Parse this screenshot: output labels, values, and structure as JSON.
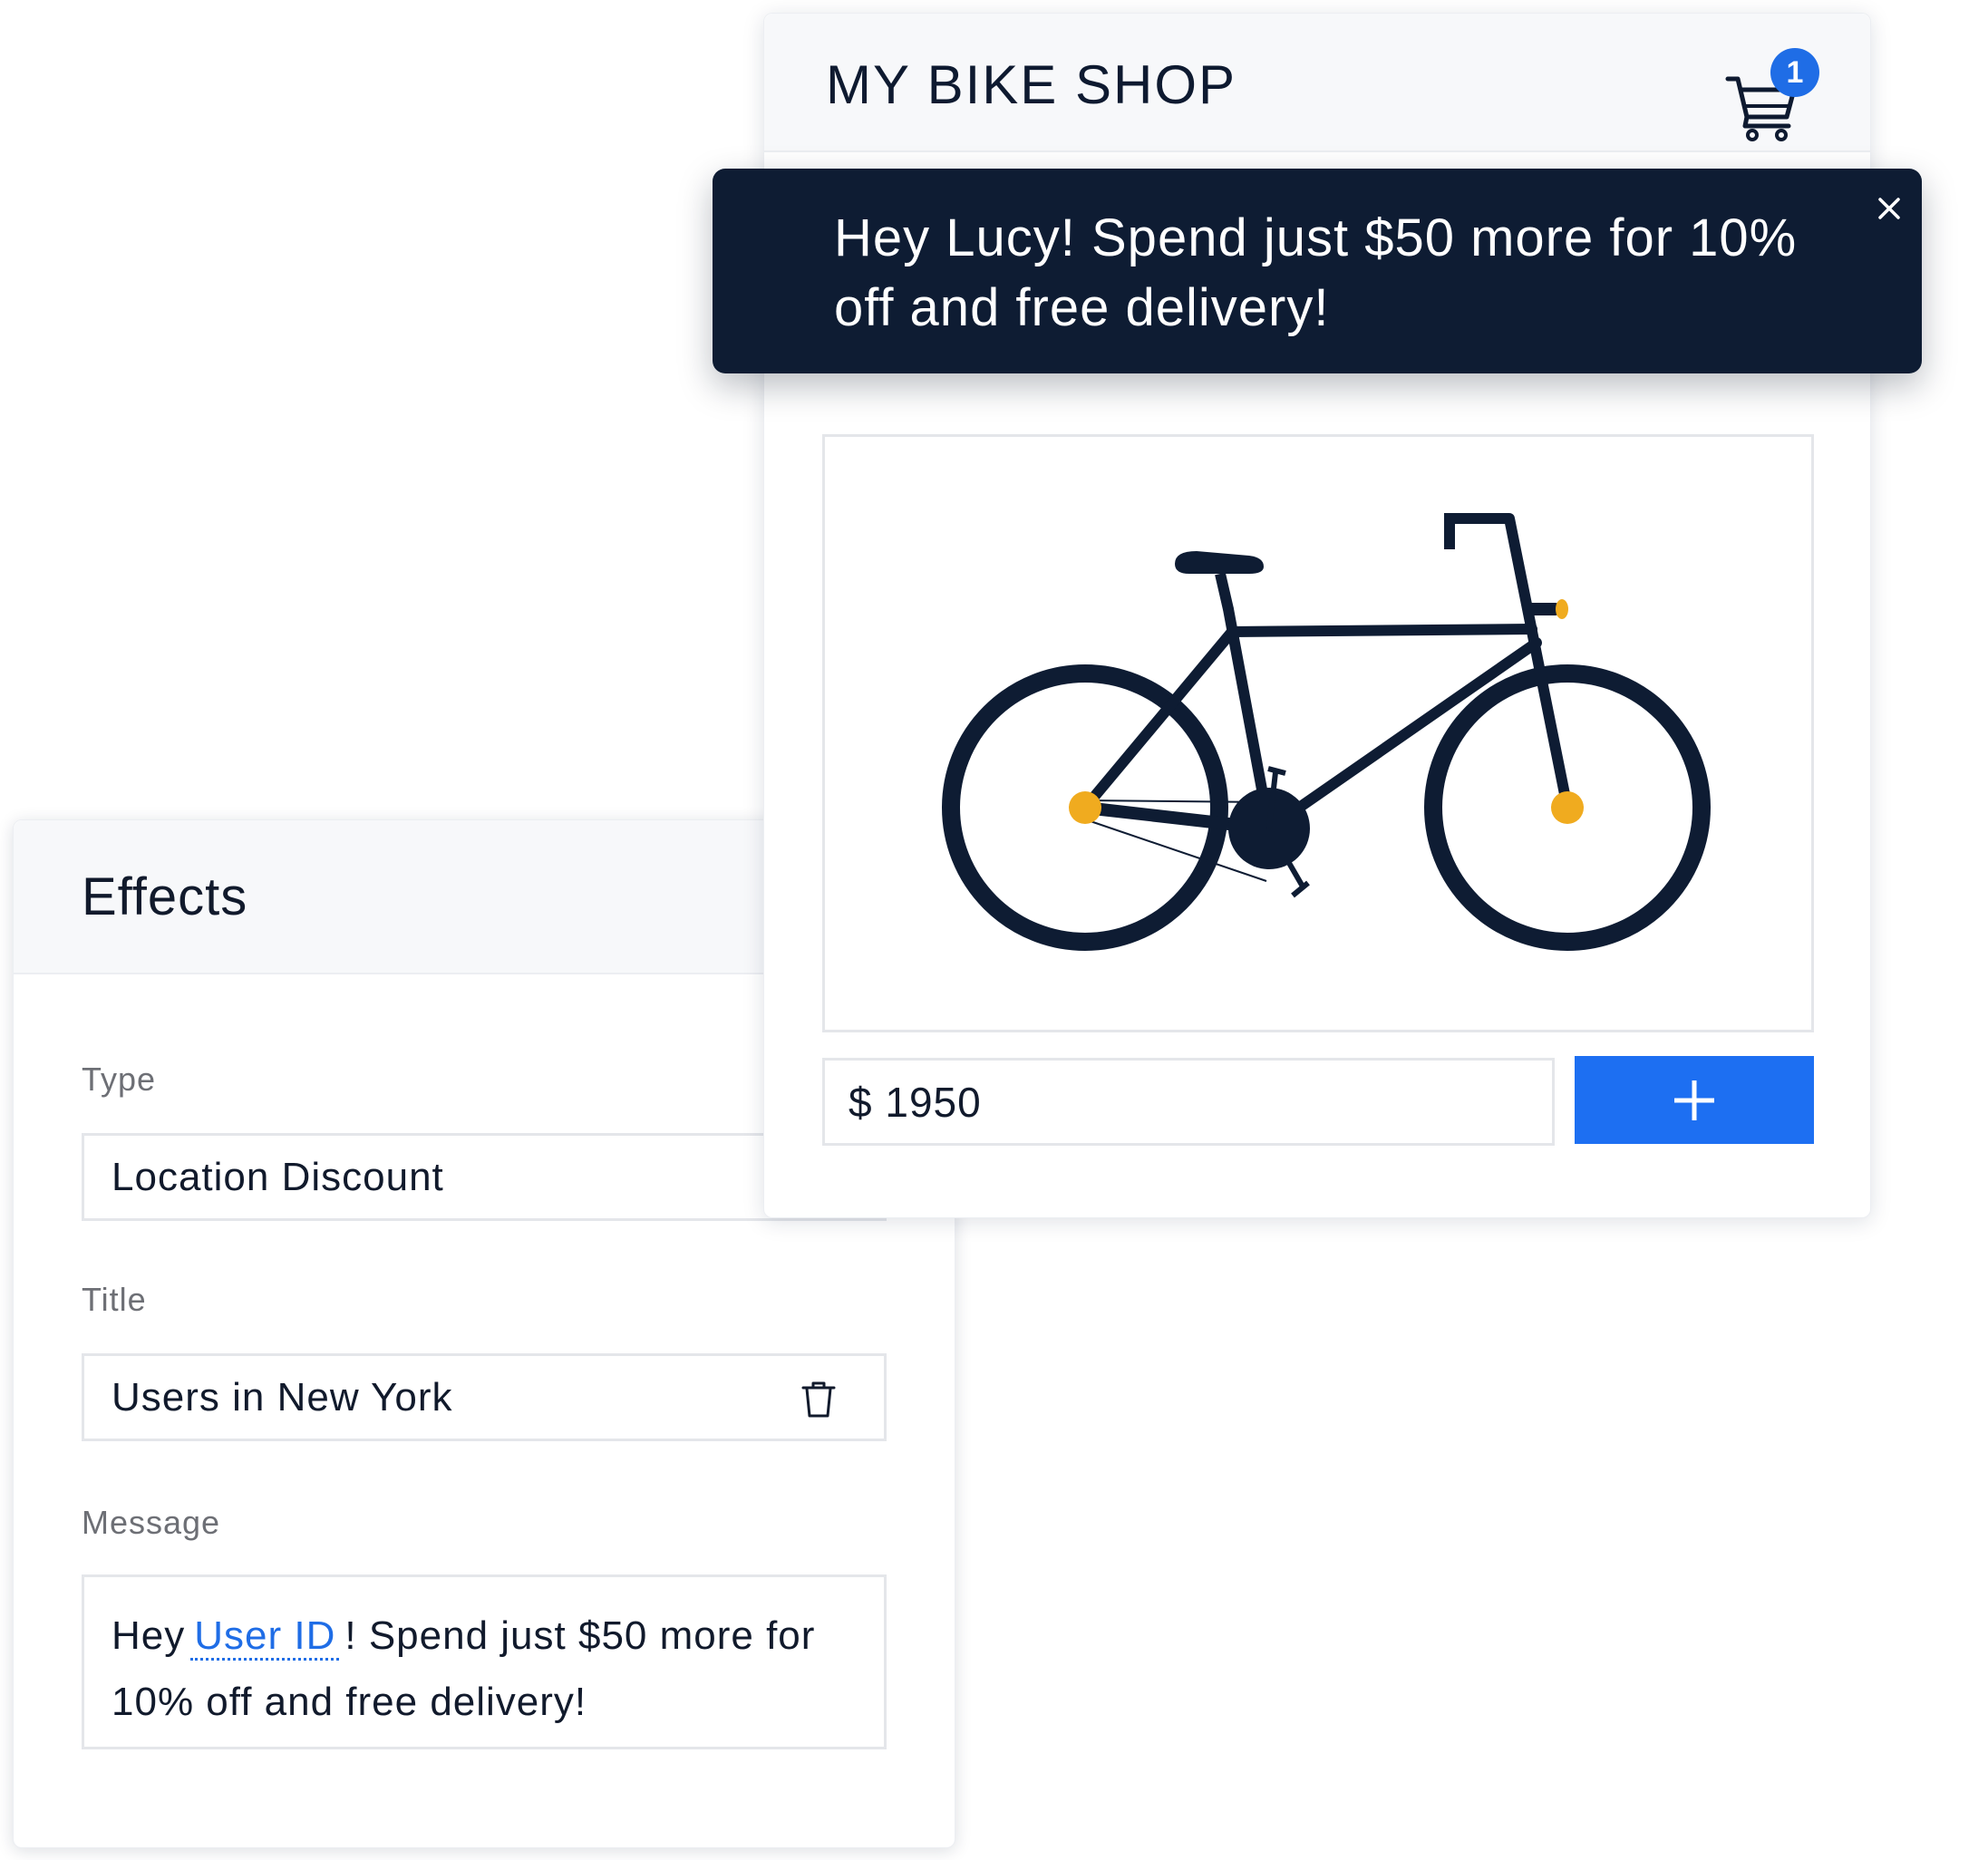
{
  "effects": {
    "title": "Effects",
    "type": {
      "label": "Type",
      "value": "Location Discount"
    },
    "title_field": {
      "label": "Title",
      "value": "Users in New York"
    },
    "message": {
      "label": "Message",
      "prefix": "Hey",
      "token": "User ID",
      "suffix": "!  Spend just $50 more for 10% off and free delivery!"
    }
  },
  "shop": {
    "title": "MY BIKE SHOP",
    "cart_count": "1",
    "price": "$ 1950",
    "add_icon": "plus-icon",
    "product_icon": "bicycle-icon"
  },
  "notification": {
    "text": "Hey Lucy! Spend just $50 more for 10% off and free delivery!"
  },
  "colors": {
    "accent": "#1f6de6",
    "dark_navy": "#0e1c33",
    "bike_hub": "#f0ab1f"
  }
}
